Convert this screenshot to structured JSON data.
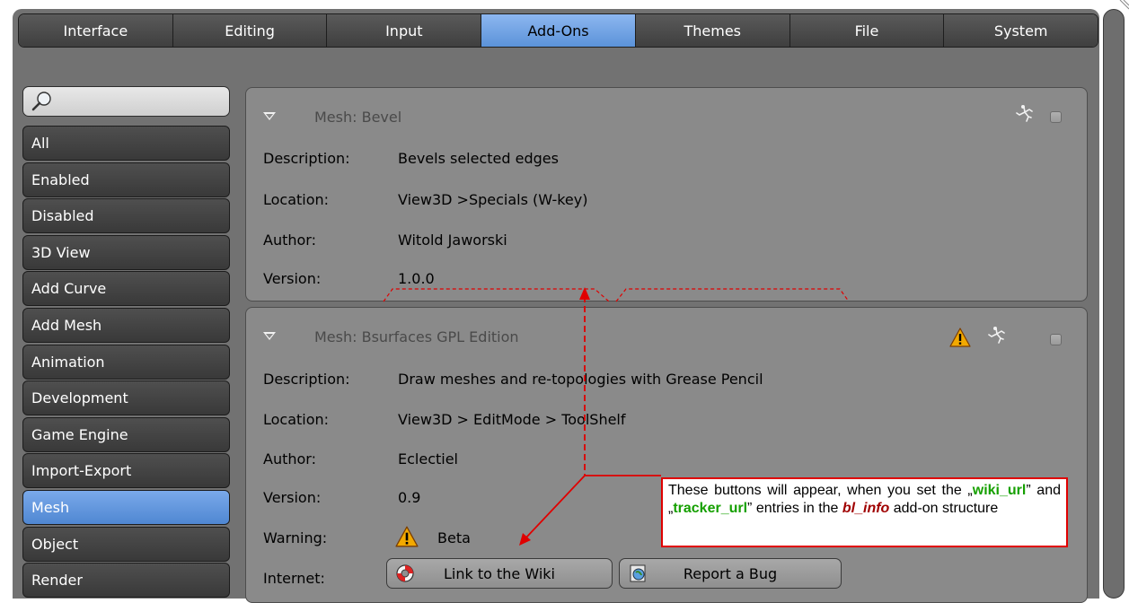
{
  "tabs": [
    {
      "label": "Interface",
      "active": false
    },
    {
      "label": "Editing",
      "active": false
    },
    {
      "label": "Input",
      "active": false
    },
    {
      "label": "Add-Ons",
      "active": true
    },
    {
      "label": "Themes",
      "active": false
    },
    {
      "label": "File",
      "active": false
    },
    {
      "label": "System",
      "active": false
    }
  ],
  "search": {
    "icon": "search-icon",
    "value": ""
  },
  "categories": [
    {
      "label": "All",
      "active": false
    },
    {
      "label": "Enabled",
      "active": false
    },
    {
      "label": "Disabled",
      "active": false
    },
    {
      "label": "3D View",
      "active": false
    },
    {
      "label": "Add Curve",
      "active": false
    },
    {
      "label": "Add Mesh",
      "active": false
    },
    {
      "label": "Animation",
      "active": false
    },
    {
      "label": "Development",
      "active": false
    },
    {
      "label": "Game Engine",
      "active": false
    },
    {
      "label": "Import-Export",
      "active": false
    },
    {
      "label": "Mesh",
      "active": true
    },
    {
      "label": "Object",
      "active": false
    },
    {
      "label": "Render",
      "active": false
    }
  ],
  "addons": [
    {
      "title": "Mesh: Bevel",
      "fields": {
        "description": {
          "label": "Description:",
          "value": "Bevels selected edges"
        },
        "location": {
          "label": "Location:",
          "value": "View3D >Specials (W-key)"
        },
        "author": {
          "label": "Author:",
          "value": "Witold Jaworski"
        },
        "version": {
          "label": "Version:",
          "value": "1.0.0"
        }
      }
    },
    {
      "title": "Mesh: Bsurfaces GPL Edition",
      "fields": {
        "description": {
          "label": "Description:",
          "value": "Draw meshes and re-topologies with Grease Pencil"
        },
        "location": {
          "label": "Location:",
          "value": "View3D > EditMode > ToolShelf"
        },
        "author": {
          "label": "Author:",
          "value": "Eclectiel"
        },
        "version": {
          "label": "Version:",
          "value": "0.9"
        },
        "warning": {
          "label": "Warning:",
          "value": "Beta"
        },
        "internet": {
          "label": "Internet:"
        }
      },
      "buttons": {
        "wiki": "Link to the Wiki",
        "bug": "Report a Bug"
      }
    }
  ],
  "annotation": {
    "t1": "These buttons will appear, when you set the „",
    "k1": "wiki_url",
    "t2": "” and „",
    "k2": "tracker_url",
    "t3": "” entries in the ",
    "k3": "bl_info",
    "t4": " add-on structure"
  },
  "colors": {
    "accent": "#5b93d9",
    "annotation_red": "#e00000",
    "annotation_green": "#16a000",
    "warning": "#f2a900"
  }
}
